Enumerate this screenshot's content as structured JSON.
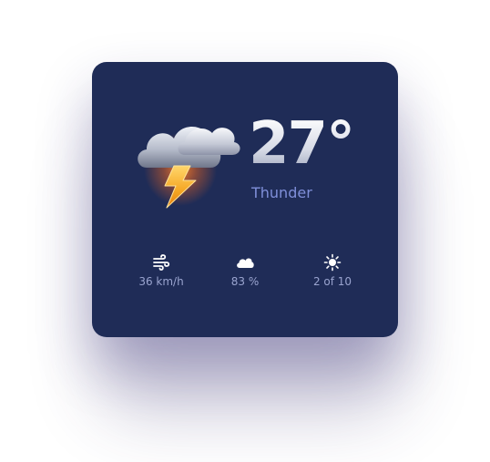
{
  "weather": {
    "temperature": "27°",
    "condition": "Thunder",
    "icon": "thunderstorm-icon"
  },
  "stats": {
    "wind": {
      "icon": "wind-icon",
      "value": "36 km/h"
    },
    "humidity": {
      "icon": "cloud-icon",
      "value": "83 %"
    },
    "uv": {
      "icon": "sun-icon",
      "value": "2 of 10"
    }
  },
  "colors": {
    "card_background": "#1f2c57",
    "condition_text": "#7f8fd9",
    "stat_text": "#9aa4cf",
    "lightning": "#f5a623"
  }
}
